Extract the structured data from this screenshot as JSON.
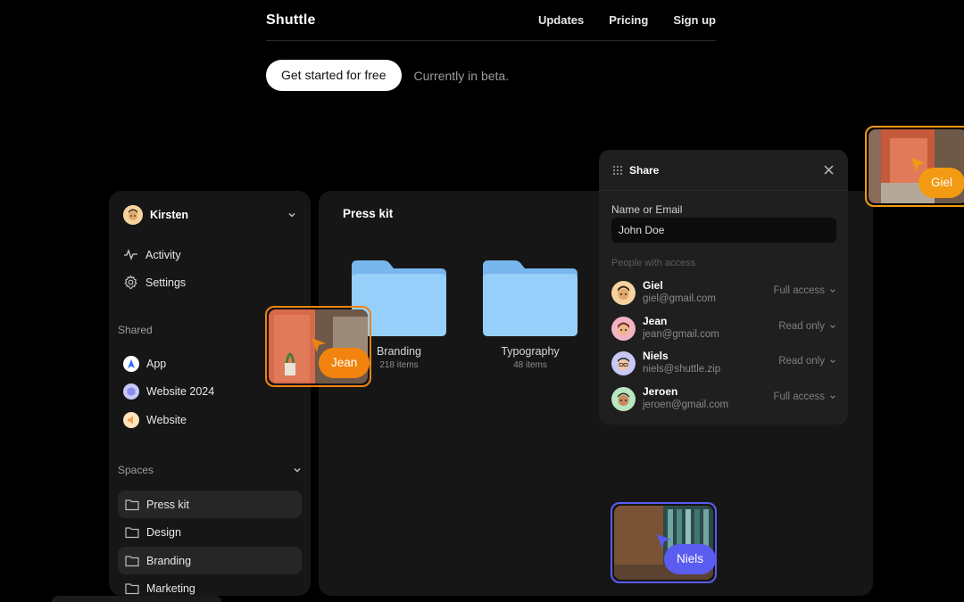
{
  "nav": {
    "brand": "Shuttle",
    "links": [
      "Updates",
      "Pricing",
      "Sign up"
    ]
  },
  "hero": {
    "cta_label": "Get started for free",
    "beta_text": "Currently in beta."
  },
  "sidebar": {
    "user": "Kirsten",
    "menu": [
      {
        "label": "Activity",
        "icon": "activity-icon"
      },
      {
        "label": "Settings",
        "icon": "gear-icon"
      }
    ],
    "shared_label": "Shared",
    "shared": [
      {
        "label": "App",
        "icon": "compass-icon",
        "color": "#2f6bff"
      },
      {
        "label": "Website 2024",
        "icon": "hexagon-icon",
        "color": "#8b8ef0"
      },
      {
        "label": "Website",
        "icon": "speaker-icon",
        "color": "#f2a04a"
      }
    ],
    "spaces_label": "Spaces",
    "spaces": [
      {
        "label": "Press kit",
        "active": true
      },
      {
        "label": "Design",
        "active": false
      },
      {
        "label": "Branding",
        "active": true
      },
      {
        "label": "Marketing",
        "active": false
      }
    ]
  },
  "main": {
    "title": "Press kit",
    "folders": [
      {
        "name": "Branding",
        "count": "218 items"
      },
      {
        "name": "Typography",
        "count": "48 items"
      }
    ]
  },
  "share": {
    "title": "Share",
    "field_label": "Name or Email",
    "field_value": "John Doe",
    "people_label": "People with access",
    "people": [
      {
        "name": "Giel",
        "email": "giel@gmail.com",
        "access": "Full access",
        "avatar_color": "#f6d2a0"
      },
      {
        "name": "Jean",
        "email": "jean@gmail.com",
        "access": "Read only",
        "avatar_color": "#f4b3c2"
      },
      {
        "name": "Niels",
        "email": "niels@shuttle.zip",
        "access": "Read only",
        "avatar_color": "#c9c7f3"
      },
      {
        "name": "Jeroen",
        "email": "jeroen@gmail.com",
        "access": "Full access",
        "avatar_color": "#b9e6c2"
      }
    ]
  },
  "cursors": [
    {
      "name": "Jean",
      "color": "#f2830f"
    },
    {
      "name": "Niels",
      "color": "#5b5cf0"
    },
    {
      "name": "Giel",
      "color": "#f29a12"
    }
  ]
}
